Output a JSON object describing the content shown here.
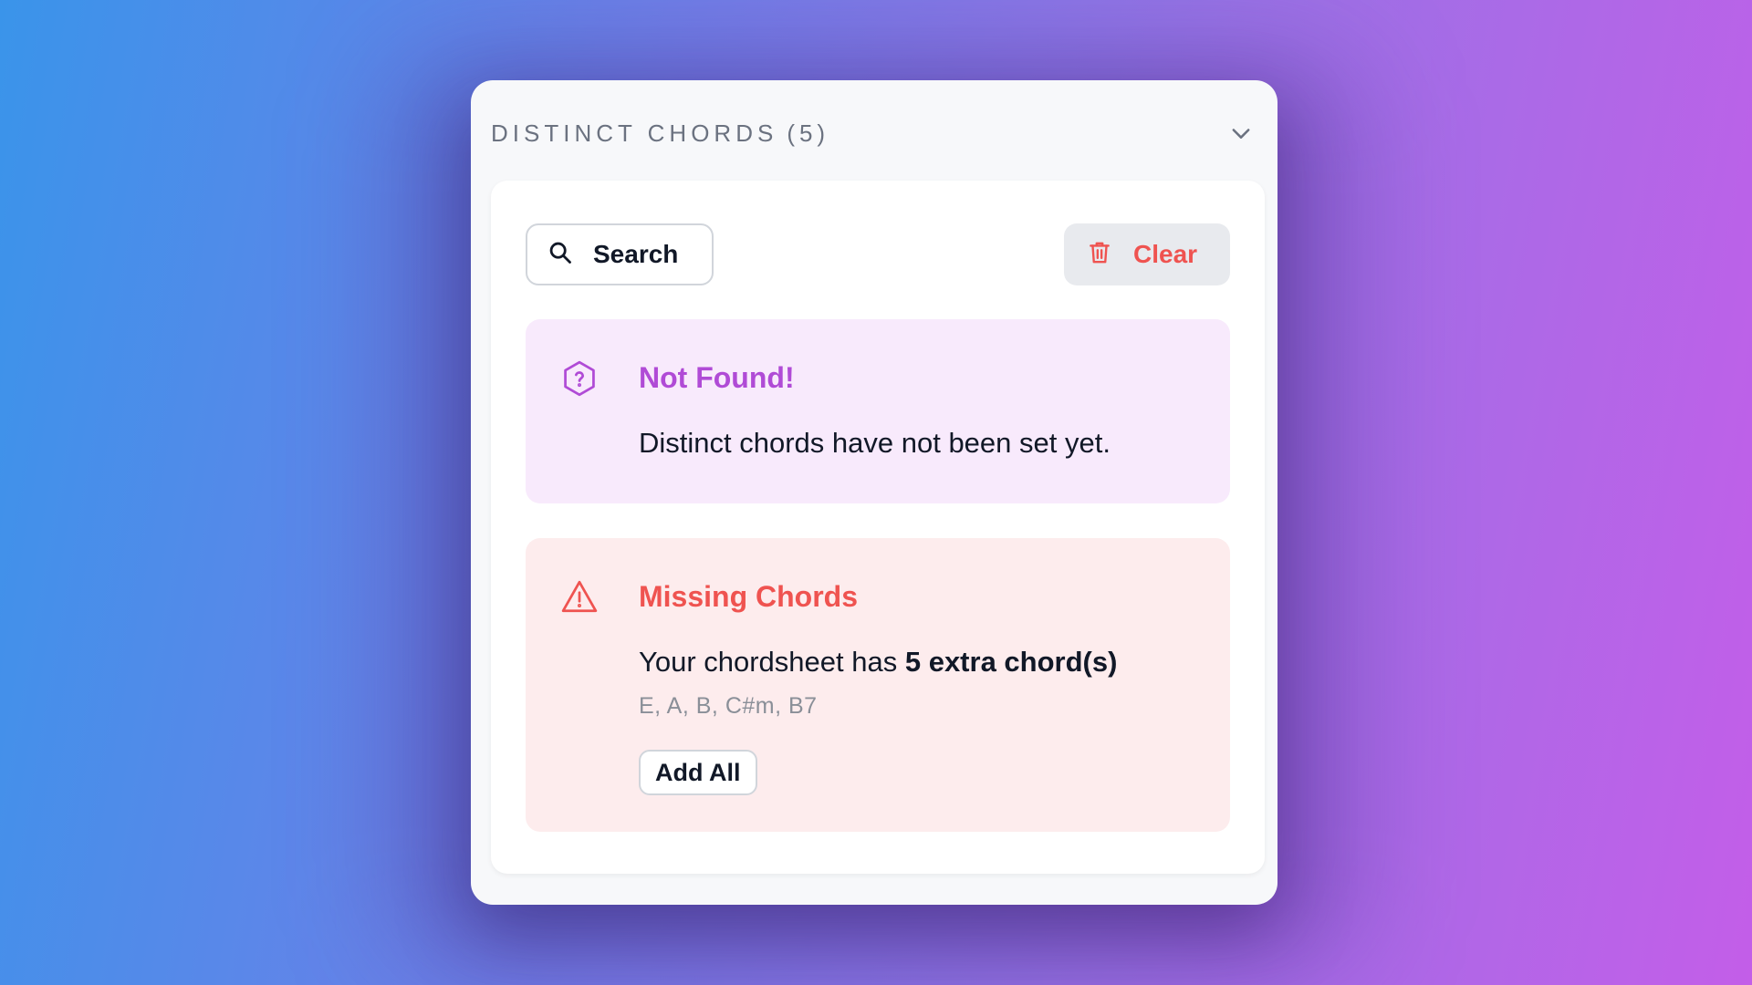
{
  "panel": {
    "title": "DISTINCT CHORDS",
    "count": "(5)",
    "collapse_icon": "chevron-down-icon"
  },
  "toolbar": {
    "search_label": "Search",
    "search_icon": "search-icon",
    "clear_label": "Clear",
    "clear_icon": "trash-icon"
  },
  "not_found_alert": {
    "icon": "question-hexagon-icon",
    "title": "Not Found!",
    "message": "Distinct chords have not been set yet."
  },
  "missing_alert": {
    "icon": "warning-triangle-icon",
    "title": "Missing Chords",
    "message_prefix": "Your chordsheet has ",
    "message_emphasis": "5 extra chord(s)",
    "chords": "E, A, B, C#m, B7",
    "add_all_label": "Add All"
  },
  "colors": {
    "info_accent": "#b04bd6",
    "info_bg": "#f8eafc",
    "warn_accent": "#ef5350",
    "warn_bg": "#fdeced"
  }
}
